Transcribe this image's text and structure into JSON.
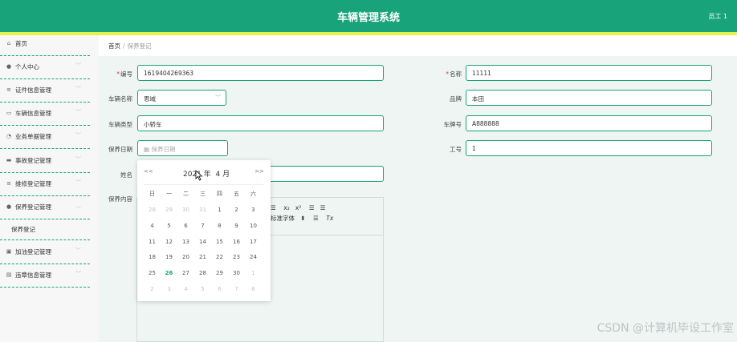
{
  "header": {
    "title": "车辆管理系统",
    "user": "员工 1"
  },
  "sidebar": {
    "items": [
      {
        "label": "首页",
        "icon": "home-icon",
        "glyph": "⌂"
      },
      {
        "label": "个人中心",
        "icon": "user-icon",
        "glyph": "●"
      },
      {
        "label": "证件信息管理",
        "icon": "list-icon",
        "glyph": "≡"
      },
      {
        "label": "车辆信息管理",
        "icon": "chat-icon",
        "glyph": "▭"
      },
      {
        "label": "业务单据管理",
        "icon": "clock-icon",
        "glyph": "◔"
      },
      {
        "label": "事故登记管理",
        "icon": "card-icon",
        "glyph": "▬"
      },
      {
        "label": "维修登记管理",
        "icon": "list-icon",
        "glyph": "≡"
      },
      {
        "label": "保养登记管理",
        "icon": "user-icon",
        "glyph": "●"
      },
      {
        "label": "加油登记管理",
        "icon": "doc-icon",
        "glyph": "▣"
      },
      {
        "label": "违章信息管理",
        "icon": "clipboard-icon",
        "glyph": "▤"
      }
    ],
    "sub_item": "保养登记"
  },
  "breadcrumb": {
    "home": "首页",
    "sep": "/",
    "current": "保养登记"
  },
  "form": {
    "bianhao_label": "编号",
    "bianhao_value": "1619404269363",
    "mingcheng_label": "名称",
    "mingcheng_value": "11111",
    "cheliangmingcheng_label": "车辆名称",
    "cheliangmingcheng_value": "思域",
    "pinpai_label": "品牌",
    "pinpai_value": "本田",
    "cheliangleixing_label": "车辆类型",
    "cheliangleixing_value": "小轿车",
    "chepaihao_label": "车牌号",
    "chepaihao_value": "A888888",
    "baoyangriqi_label": "保养日期",
    "baoyangriqi_placeholder": "保养日期",
    "gonghao_label": "工号",
    "gonghao_value": "1",
    "xingming_label": "姓名",
    "baoyangneirong_label": "保养内容",
    "required_mark": "*"
  },
  "editor_toolbar": {
    "list_sym": "☰",
    "sub": "x₂",
    "sup": "x²",
    "indent1": "☰",
    "indent2": "☰",
    "font": "标准字体",
    "font_arrow": "⬍",
    "align": "☰",
    "clear": "Tx"
  },
  "datepicker": {
    "prev": "<<",
    "next": ">>",
    "title_year": "2021 年",
    "title_month": "4 月",
    "weekdays": [
      "日",
      "一",
      "二",
      "三",
      "四",
      "五",
      "六"
    ],
    "weeks": [
      [
        "28",
        "29",
        "30",
        "31",
        "1",
        "2",
        "3"
      ],
      [
        "4",
        "5",
        "6",
        "7",
        "8",
        "9",
        "10"
      ],
      [
        "11",
        "12",
        "13",
        "14",
        "15",
        "16",
        "17"
      ],
      [
        "18",
        "19",
        "20",
        "21",
        "22",
        "23",
        "24"
      ],
      [
        "25",
        "26",
        "27",
        "28",
        "29",
        "30",
        "1"
      ],
      [
        "2",
        "3",
        "4",
        "5",
        "6",
        "7",
        "8"
      ]
    ],
    "today": "26"
  },
  "watermark": "CSDN @计算机毕设工作室",
  "colors": {
    "primary": "#18a37a",
    "accent_bar": "#e8f04a",
    "main_bg": "#eef5f2"
  }
}
